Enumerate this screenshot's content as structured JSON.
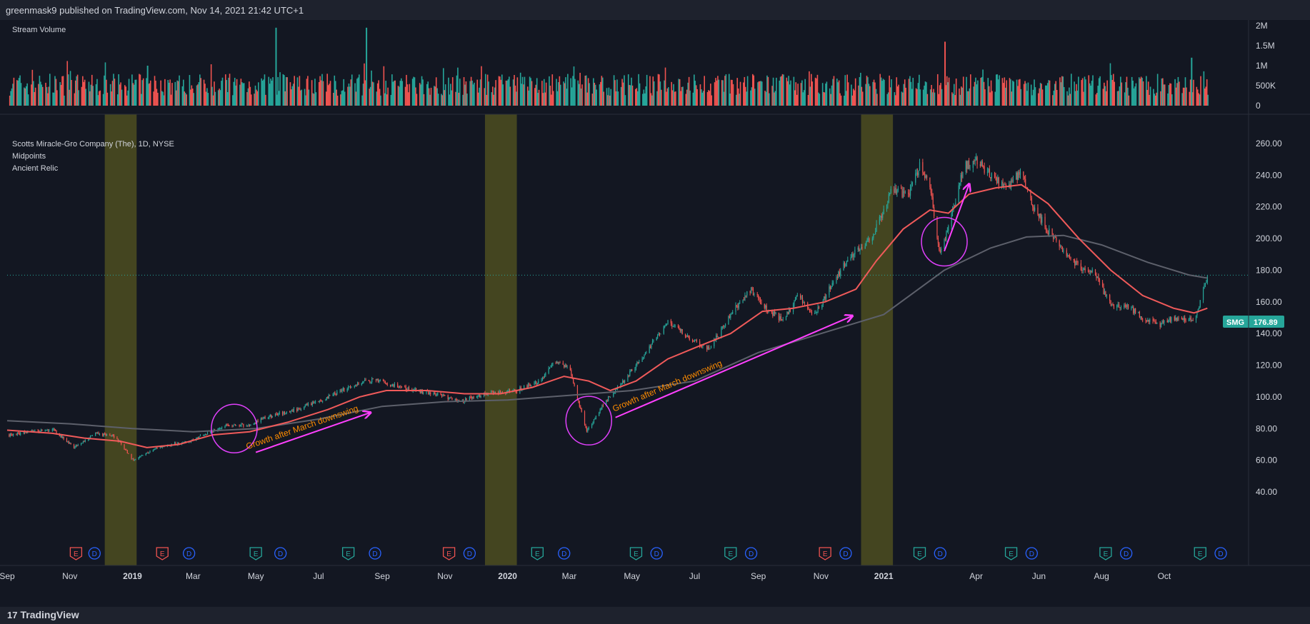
{
  "header": {
    "publisher": "greenmask9 published on TradingView.com, Nov 14, 2021 21:42 UTC+1"
  },
  "footer": {
    "brand": "TradingView",
    "brand_mark": "17"
  },
  "volume_pane": {
    "title": "Stream Volume"
  },
  "main_pane": {
    "title": "Scotts Miracle-Gro Company (The), 1D, NYSE",
    "indicator_1": "Midpoints",
    "indicator_2": "Ancient Relic"
  },
  "price_tag": {
    "symbol": "SMG",
    "value": "176.89",
    "color": "#26a69a"
  },
  "annotations": [
    {
      "text": "Growth after March downswing"
    },
    {
      "text": "Growth after March downswing"
    }
  ],
  "events": [
    {
      "letter": "E",
      "kind": "earnings-miss"
    },
    {
      "letter": "D",
      "kind": "dividend"
    },
    {
      "letter": "E",
      "kind": "earnings-miss"
    },
    {
      "letter": "D",
      "kind": "dividend"
    },
    {
      "letter": "E",
      "kind": "earnings-beat"
    },
    {
      "letter": "D",
      "kind": "dividend"
    },
    {
      "letter": "E",
      "kind": "earnings-beat"
    },
    {
      "letter": "D",
      "kind": "dividend"
    },
    {
      "letter": "E",
      "kind": "earnings-miss"
    },
    {
      "letter": "D",
      "kind": "dividend"
    },
    {
      "letter": "E",
      "kind": "earnings-beat"
    },
    {
      "letter": "D",
      "kind": "dividend"
    },
    {
      "letter": "E",
      "kind": "earnings-beat"
    },
    {
      "letter": "D",
      "kind": "dividend"
    },
    {
      "letter": "E",
      "kind": "earnings-beat"
    },
    {
      "letter": "D",
      "kind": "dividend"
    },
    {
      "letter": "E",
      "kind": "earnings-miss"
    },
    {
      "letter": "D",
      "kind": "dividend"
    },
    {
      "letter": "E",
      "kind": "earnings-beat"
    },
    {
      "letter": "D",
      "kind": "dividend"
    },
    {
      "letter": "E",
      "kind": "earnings-beat"
    },
    {
      "letter": "D",
      "kind": "dividend"
    },
    {
      "letter": "E",
      "kind": "earnings-beat"
    },
    {
      "letter": "D",
      "kind": "dividend"
    },
    {
      "letter": "E",
      "kind": "earnings-beat"
    },
    {
      "letter": "D",
      "kind": "dividend"
    }
  ],
  "colors": {
    "bg": "#131722",
    "up": "#26a69a",
    "down": "#ef5350",
    "ma_fast": "#f05a5a",
    "ma_slow": "#5d606b",
    "highlight": "#4a4a20",
    "annotation": "#ff8c00",
    "arrow": "#ff40ff"
  },
  "chart_data": [
    {
      "type": "bar",
      "title": "Stream Volume",
      "ylim": [
        0,
        2000000
      ],
      "y_ticks": [
        "2M",
        "1.5M",
        "1M",
        "500K",
        "0"
      ],
      "y_tick_values": [
        2000000,
        1500000,
        1000000,
        500000,
        0
      ],
      "spikes": [
        {
          "date": "2019-01-15",
          "value": 1000000,
          "dir": "up"
        },
        {
          "date": "2019-05-20",
          "value": 1950000,
          "dir": "up"
        },
        {
          "date": "2019-08-16",
          "value": 1950000,
          "dir": "up"
        },
        {
          "date": "2021-03-01",
          "value": 1600000,
          "dir": "down"
        },
        {
          "date": "2021-10-27",
          "value": 1200000,
          "dir": "up"
        }
      ],
      "typical_range": [
        250000,
        800000
      ]
    },
    {
      "type": "candlestick",
      "title": "Scotts Miracle-Gro Company (The), 1D, NYSE",
      "ylim": [
        40,
        270
      ],
      "y_ticks": [
        "260.00",
        "240.00",
        "220.00",
        "200.00",
        "180.00",
        "160.00",
        "140.00",
        "120.00",
        "100.00",
        "80.00",
        "60.00",
        "40.00"
      ],
      "y_tick_values": [
        260,
        240,
        220,
        200,
        180,
        160,
        140,
        120,
        100,
        80,
        60,
        40
      ],
      "x_ticks": [
        "Sep",
        "Nov",
        "2019",
        "Mar",
        "May",
        "Jul",
        "Sep",
        "Nov",
        "2020",
        "Mar",
        "May",
        "Jul",
        "Sep",
        "Nov",
        "2021",
        "Apr",
        "Jun",
        "Aug",
        "Oct"
      ],
      "x_tick_dates": [
        "2018-09-01",
        "2018-11-01",
        "2019-01-01",
        "2019-03-01",
        "2019-05-01",
        "2019-07-01",
        "2019-09-01",
        "2019-11-01",
        "2020-01-01",
        "2020-03-01",
        "2020-05-01",
        "2020-07-01",
        "2020-09-01",
        "2020-11-01",
        "2021-01-01",
        "2021-04-01",
        "2021-06-01",
        "2021-08-01",
        "2021-10-01"
      ],
      "x_range": [
        "2018-09-01",
        "2021-12-20"
      ],
      "last_price": 176.89,
      "price_path": [
        [
          "2018-09-01",
          76
        ],
        [
          "2018-10-15",
          80
        ],
        [
          "2018-11-05",
          68
        ],
        [
          "2018-11-25",
          77
        ],
        [
          "2018-12-15",
          75
        ],
        [
          "2019-01-02",
          60
        ],
        [
          "2019-01-25",
          68
        ],
        [
          "2019-02-25",
          72
        ],
        [
          "2019-04-01",
          82
        ],
        [
          "2019-04-25",
          82
        ],
        [
          "2019-05-10",
          87
        ],
        [
          "2019-06-10",
          92
        ],
        [
          "2019-07-10",
          100
        ],
        [
          "2019-08-05",
          108
        ],
        [
          "2019-08-25",
          111
        ],
        [
          "2019-09-25",
          105
        ],
        [
          "2019-10-25",
          102
        ],
        [
          "2019-11-15",
          97
        ],
        [
          "2019-12-10",
          102
        ],
        [
          "2020-01-10",
          104
        ],
        [
          "2020-02-01",
          110
        ],
        [
          "2020-02-15",
          122
        ],
        [
          "2020-03-01",
          118
        ],
        [
          "2020-03-18",
          78
        ],
        [
          "2020-04-05",
          97
        ],
        [
          "2020-04-20",
          108
        ],
        [
          "2020-05-15",
          128
        ],
        [
          "2020-06-05",
          148
        ],
        [
          "2020-06-25",
          138
        ],
        [
          "2020-07-15",
          130
        ],
        [
          "2020-08-05",
          152
        ],
        [
          "2020-08-25",
          168
        ],
        [
          "2020-09-10",
          155
        ],
        [
          "2020-09-25",
          148
        ],
        [
          "2020-10-10",
          164
        ],
        [
          "2020-10-25",
          150
        ],
        [
          "2020-11-10",
          170
        ],
        [
          "2020-12-01",
          190
        ],
        [
          "2020-12-20",
          200
        ],
        [
          "2021-01-10",
          232
        ],
        [
          "2021-01-25",
          226
        ],
        [
          "2021-02-05",
          246
        ],
        [
          "2021-02-15",
          232
        ],
        [
          "2021-02-25",
          190
        ],
        [
          "2021-03-05",
          208
        ],
        [
          "2021-03-20",
          245
        ],
        [
          "2021-04-01",
          250
        ],
        [
          "2021-04-15",
          240
        ],
        [
          "2021-05-01",
          232
        ],
        [
          "2021-05-15",
          243
        ],
        [
          "2021-05-25",
          222
        ],
        [
          "2021-06-10",
          205
        ],
        [
          "2021-06-25",
          193
        ],
        [
          "2021-07-10",
          182
        ],
        [
          "2021-07-25",
          178
        ],
        [
          "2021-08-10",
          158
        ],
        [
          "2021-08-25",
          158
        ],
        [
          "2021-09-10",
          150
        ],
        [
          "2021-09-25",
          145
        ],
        [
          "2021-10-10",
          150
        ],
        [
          "2021-10-30",
          148
        ],
        [
          "2021-11-05",
          160
        ],
        [
          "2021-11-12",
          176.89
        ]
      ],
      "ma_fast": [
        [
          "2018-09-01",
          79
        ],
        [
          "2018-10-15",
          77
        ],
        [
          "2018-11-15",
          74
        ],
        [
          "2018-12-20",
          72
        ],
        [
          "2019-01-15",
          68
        ],
        [
          "2019-02-15",
          70
        ],
        [
          "2019-03-20",
          76
        ],
        [
          "2019-04-25",
          78
        ],
        [
          "2019-06-01",
          84
        ],
        [
          "2019-07-10",
          92
        ],
        [
          "2019-08-10",
          100
        ],
        [
          "2019-09-05",
          104
        ],
        [
          "2019-10-15",
          104
        ],
        [
          "2019-11-20",
          102
        ],
        [
          "2019-12-25",
          102
        ],
        [
          "2020-01-25",
          106
        ],
        [
          "2020-02-25",
          113
        ],
        [
          "2020-03-20",
          110
        ],
        [
          "2020-04-10",
          104
        ],
        [
          "2020-05-05",
          110
        ],
        [
          "2020-06-05",
          124
        ],
        [
          "2020-07-05",
          132
        ],
        [
          "2020-08-05",
          140
        ],
        [
          "2020-09-05",
          154
        ],
        [
          "2020-10-05",
          156
        ],
        [
          "2020-11-05",
          160
        ],
        [
          "2020-12-05",
          168
        ],
        [
          "2020-12-25",
          186
        ],
        [
          "2021-01-20",
          206
        ],
        [
          "2021-02-15",
          218
        ],
        [
          "2021-03-05",
          216
        ],
        [
          "2021-03-25",
          228
        ],
        [
          "2021-04-20",
          232
        ],
        [
          "2021-05-15",
          234
        ],
        [
          "2021-06-10",
          222
        ],
        [
          "2021-07-10",
          200
        ],
        [
          "2021-08-10",
          180
        ],
        [
          "2021-09-10",
          164
        ],
        [
          "2021-10-10",
          156
        ],
        [
          "2021-10-30",
          153
        ],
        [
          "2021-11-12",
          156
        ]
      ],
      "ma_slow": [
        [
          "2018-09-01",
          85
        ],
        [
          "2018-11-01",
          83
        ],
        [
          "2019-01-01",
          80
        ],
        [
          "2019-03-01",
          78
        ],
        [
          "2019-05-01",
          80
        ],
        [
          "2019-07-01",
          86
        ],
        [
          "2019-09-01",
          94
        ],
        [
          "2019-11-01",
          97
        ],
        [
          "2020-01-01",
          98
        ],
        [
          "2020-03-01",
          101
        ],
        [
          "2020-05-01",
          104
        ],
        [
          "2020-07-01",
          110
        ],
        [
          "2020-09-01",
          128
        ],
        [
          "2020-11-01",
          140
        ],
        [
          "2021-01-01",
          152
        ],
        [
          "2021-03-01",
          180
        ],
        [
          "2021-04-15",
          194
        ],
        [
          "2021-05-20",
          201
        ],
        [
          "2021-06-25",
          202
        ],
        [
          "2021-08-01",
          196
        ],
        [
          "2021-09-15",
          185
        ],
        [
          "2021-10-25",
          177
        ],
        [
          "2021-11-12",
          175
        ]
      ],
      "highlight_periods": [
        [
          "2018-12-05",
          "2019-01-05"
        ],
        [
          "2019-12-10",
          "2020-01-10"
        ],
        [
          "2020-12-10",
          "2021-01-10"
        ]
      ],
      "event_dates": [
        "2018-11-07",
        "2018-11-25",
        "2019-01-30",
        "2019-02-25",
        "2019-05-01",
        "2019-05-25",
        "2019-07-30",
        "2019-08-25",
        "2019-11-05",
        "2019-11-25",
        "2020-01-30",
        "2020-02-25",
        "2020-05-05",
        "2020-05-25",
        "2020-08-05",
        "2020-08-25",
        "2020-11-05",
        "2020-11-25",
        "2021-02-05",
        "2021-02-25",
        "2021-05-05",
        "2021-05-25",
        "2021-08-05",
        "2021-08-25",
        "2021-11-05",
        "2021-11-25"
      ],
      "circles": [
        {
          "center": [
            "2019-04-10",
            80
          ],
          "label": ""
        },
        {
          "center": [
            "2020-03-20",
            85
          ],
          "label": ""
        },
        {
          "center": [
            "2021-03-01",
            198
          ],
          "label": ""
        }
      ],
      "arrows": [
        {
          "from": [
            "2019-05-01",
            65
          ],
          "to": [
            "2019-08-20",
            90
          ]
        },
        {
          "from": [
            "2020-04-15",
            87
          ],
          "to": [
            "2020-12-01",
            151
          ]
        },
        {
          "from": [
            "2021-03-01",
            192
          ],
          "to": [
            "2021-03-25",
            234
          ]
        }
      ]
    }
  ]
}
